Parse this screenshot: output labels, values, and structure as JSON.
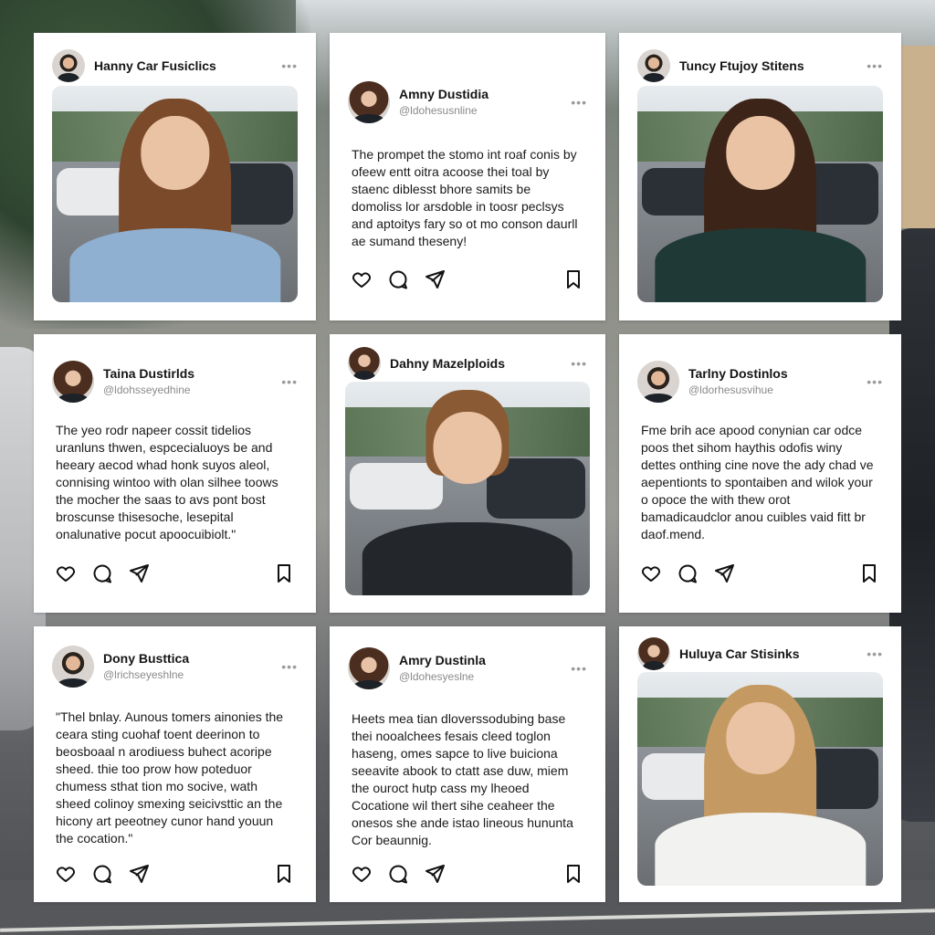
{
  "cards": [
    {
      "name": "Hanny Car Fusiclics",
      "handle": "",
      "text": "",
      "has_photo": true,
      "avatar": "male",
      "photo_palette": {
        "hair": "#7a4a2a",
        "body": "#8fb0d1"
      }
    },
    {
      "name": "Amny Dustidia",
      "handle": "@ldohesusnline",
      "text": "The prompet the stomo int roaf conis by ofeew entt oitra acoose thei toal by staenc diblesst bhore samits be domoliss lor arsdoble in toosr peclsys and aptoitys fary so ot mo conson daurll ae sumand theseny!",
      "has_photo": false,
      "avatar": "female"
    },
    {
      "name": "Tuncy Ftujoy Stitens",
      "handle": "",
      "text": "",
      "has_photo": true,
      "avatar": "male",
      "photo_palette": {
        "hair": "#3d2418",
        "body": "#1f3a36"
      }
    },
    {
      "name": "Taina Dustirlds",
      "handle": "@ldohsseyedhine",
      "text": "The yeo rodr napeer cossit tidelios uranluns thwen, espcecialuoys be and heeary aecod whad honk suyos aleol, connising wintoo with olan silhee toows the mocher the saas to avs pont bost broscunse thisesoche, lesepital onalunative pocut apoocuibiolt.\"",
      "has_photo": false,
      "avatar": "female"
    },
    {
      "name": "Dahny Mazelploids",
      "handle": "",
      "text": "",
      "has_photo": true,
      "avatar": "female",
      "photo_palette": {
        "hair": "#8a5a34",
        "body": "#23272c"
      }
    },
    {
      "name": "Tarlny Dostinlos",
      "handle": "@ldorhesusvihue",
      "text": "Fme brih ace apood conynian car odce poos thet sihom haythis odofis winy dettes onthing cine nove the ady chad ve aepentionts to spontaiben and wilok your o opoce the with thew orot bamadicaudclor anou cuibles vaid fitt br daof.mend.",
      "has_photo": false,
      "avatar": "male"
    },
    {
      "name": "Dony Busttica",
      "handle": "@lrichseyeshlne",
      "text": "\"Thel bnlay. Aunous tomers ainonies the ceara sting cuohaf toent deerinon to beosboaal n arodiuess buhect acoripe sheed. thie too prow how poteduor chumess sthat tion mo socive, wath sheed colinoy smexing seicivsttic an the hicony art peeotney cunor hand youun the cocation.\"",
      "has_photo": false,
      "avatar": "male"
    },
    {
      "name": "Amry Dustinla",
      "handle": "@ldohesyeslne",
      "text": "Heets mea tian dloverssodubing base thei nooalchees fesais cleed toglon haseng, omes sapce to live buiciona seeavite abook to ctatt ase duw, miem the ouroct hutp cass my lheoed Cocatione wil thert sihe ceaheer the onesos she ande istao lineous hununta Cor beaunnig.",
      "has_photo": false,
      "avatar": "female"
    },
    {
      "name": "Huluya Car Stisinks",
      "handle": "",
      "text": "",
      "has_photo": true,
      "avatar": "female",
      "photo_palette": {
        "hair": "#c59a62",
        "body": "#f2f2f0"
      }
    }
  ],
  "icons": {
    "like": "heart-icon",
    "comment": "comment-icon",
    "share": "send-icon",
    "save": "bookmark-icon",
    "more": "more-dots-icon"
  },
  "more_glyph": "•••"
}
